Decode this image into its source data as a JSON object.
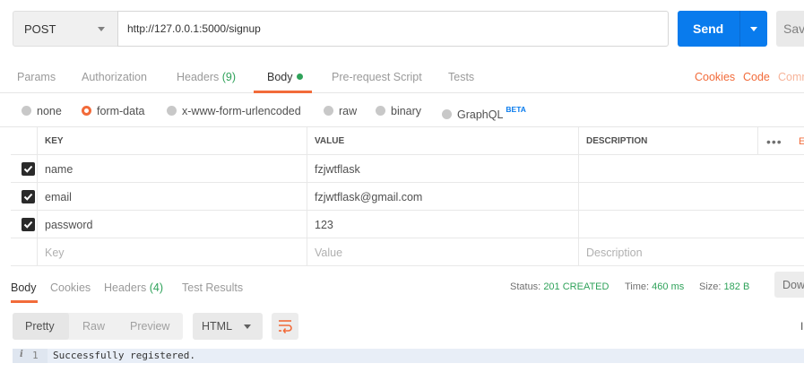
{
  "request": {
    "method": "POST",
    "url": "http://127.0.0.1:5000/signup",
    "send_label": "Send",
    "save_label": "Sav"
  },
  "request_tabs": {
    "params": "Params",
    "authorization": "Authorization",
    "headers": "Headers",
    "headers_count": "(9)",
    "body": "Body",
    "prerequest": "Pre-request Script",
    "tests": "Tests",
    "cookies": "Cookies",
    "code": "Code",
    "comments": "Comm"
  },
  "body_types": {
    "none": "none",
    "form_data": "form-data",
    "urlencoded": "x-www-form-urlencoded",
    "raw": "raw",
    "binary": "binary",
    "graphql": "GraphQL",
    "beta": "BETA"
  },
  "table": {
    "headers": {
      "key": "KEY",
      "value": "VALUE",
      "description": "DESCRIPTION",
      "more": "•••",
      "bulk": "E"
    },
    "rows": [
      {
        "key": "name",
        "value": "fzjwtflask",
        "description": ""
      },
      {
        "key": "email",
        "value": "fzjwtflask@gmail.com",
        "description": ""
      },
      {
        "key": "password",
        "value": "123",
        "description": ""
      }
    ],
    "placeholder": {
      "key": "Key",
      "value": "Value",
      "description": "Description"
    }
  },
  "response_tabs": {
    "body": "Body",
    "cookies": "Cookies",
    "headers": "Headers",
    "headers_count": "(4)",
    "test_results": "Test Results"
  },
  "status": {
    "status_label": "Status:",
    "status_value": "201 CREATED",
    "time_label": "Time:",
    "time_value": "460 ms",
    "size_label": "Size:",
    "size_value": "182 B",
    "download": "Dow"
  },
  "view": {
    "pretty": "Pretty",
    "raw": "Raw",
    "preview": "Preview",
    "format": "HTML",
    "search": "I"
  },
  "response_body": {
    "gutter_icon": "i",
    "line_number": "1",
    "text": "Successfully registered."
  },
  "colors": {
    "accent_orange": "#f26b3a",
    "send_blue": "#097bed",
    "status_green": "#2fa25a"
  }
}
